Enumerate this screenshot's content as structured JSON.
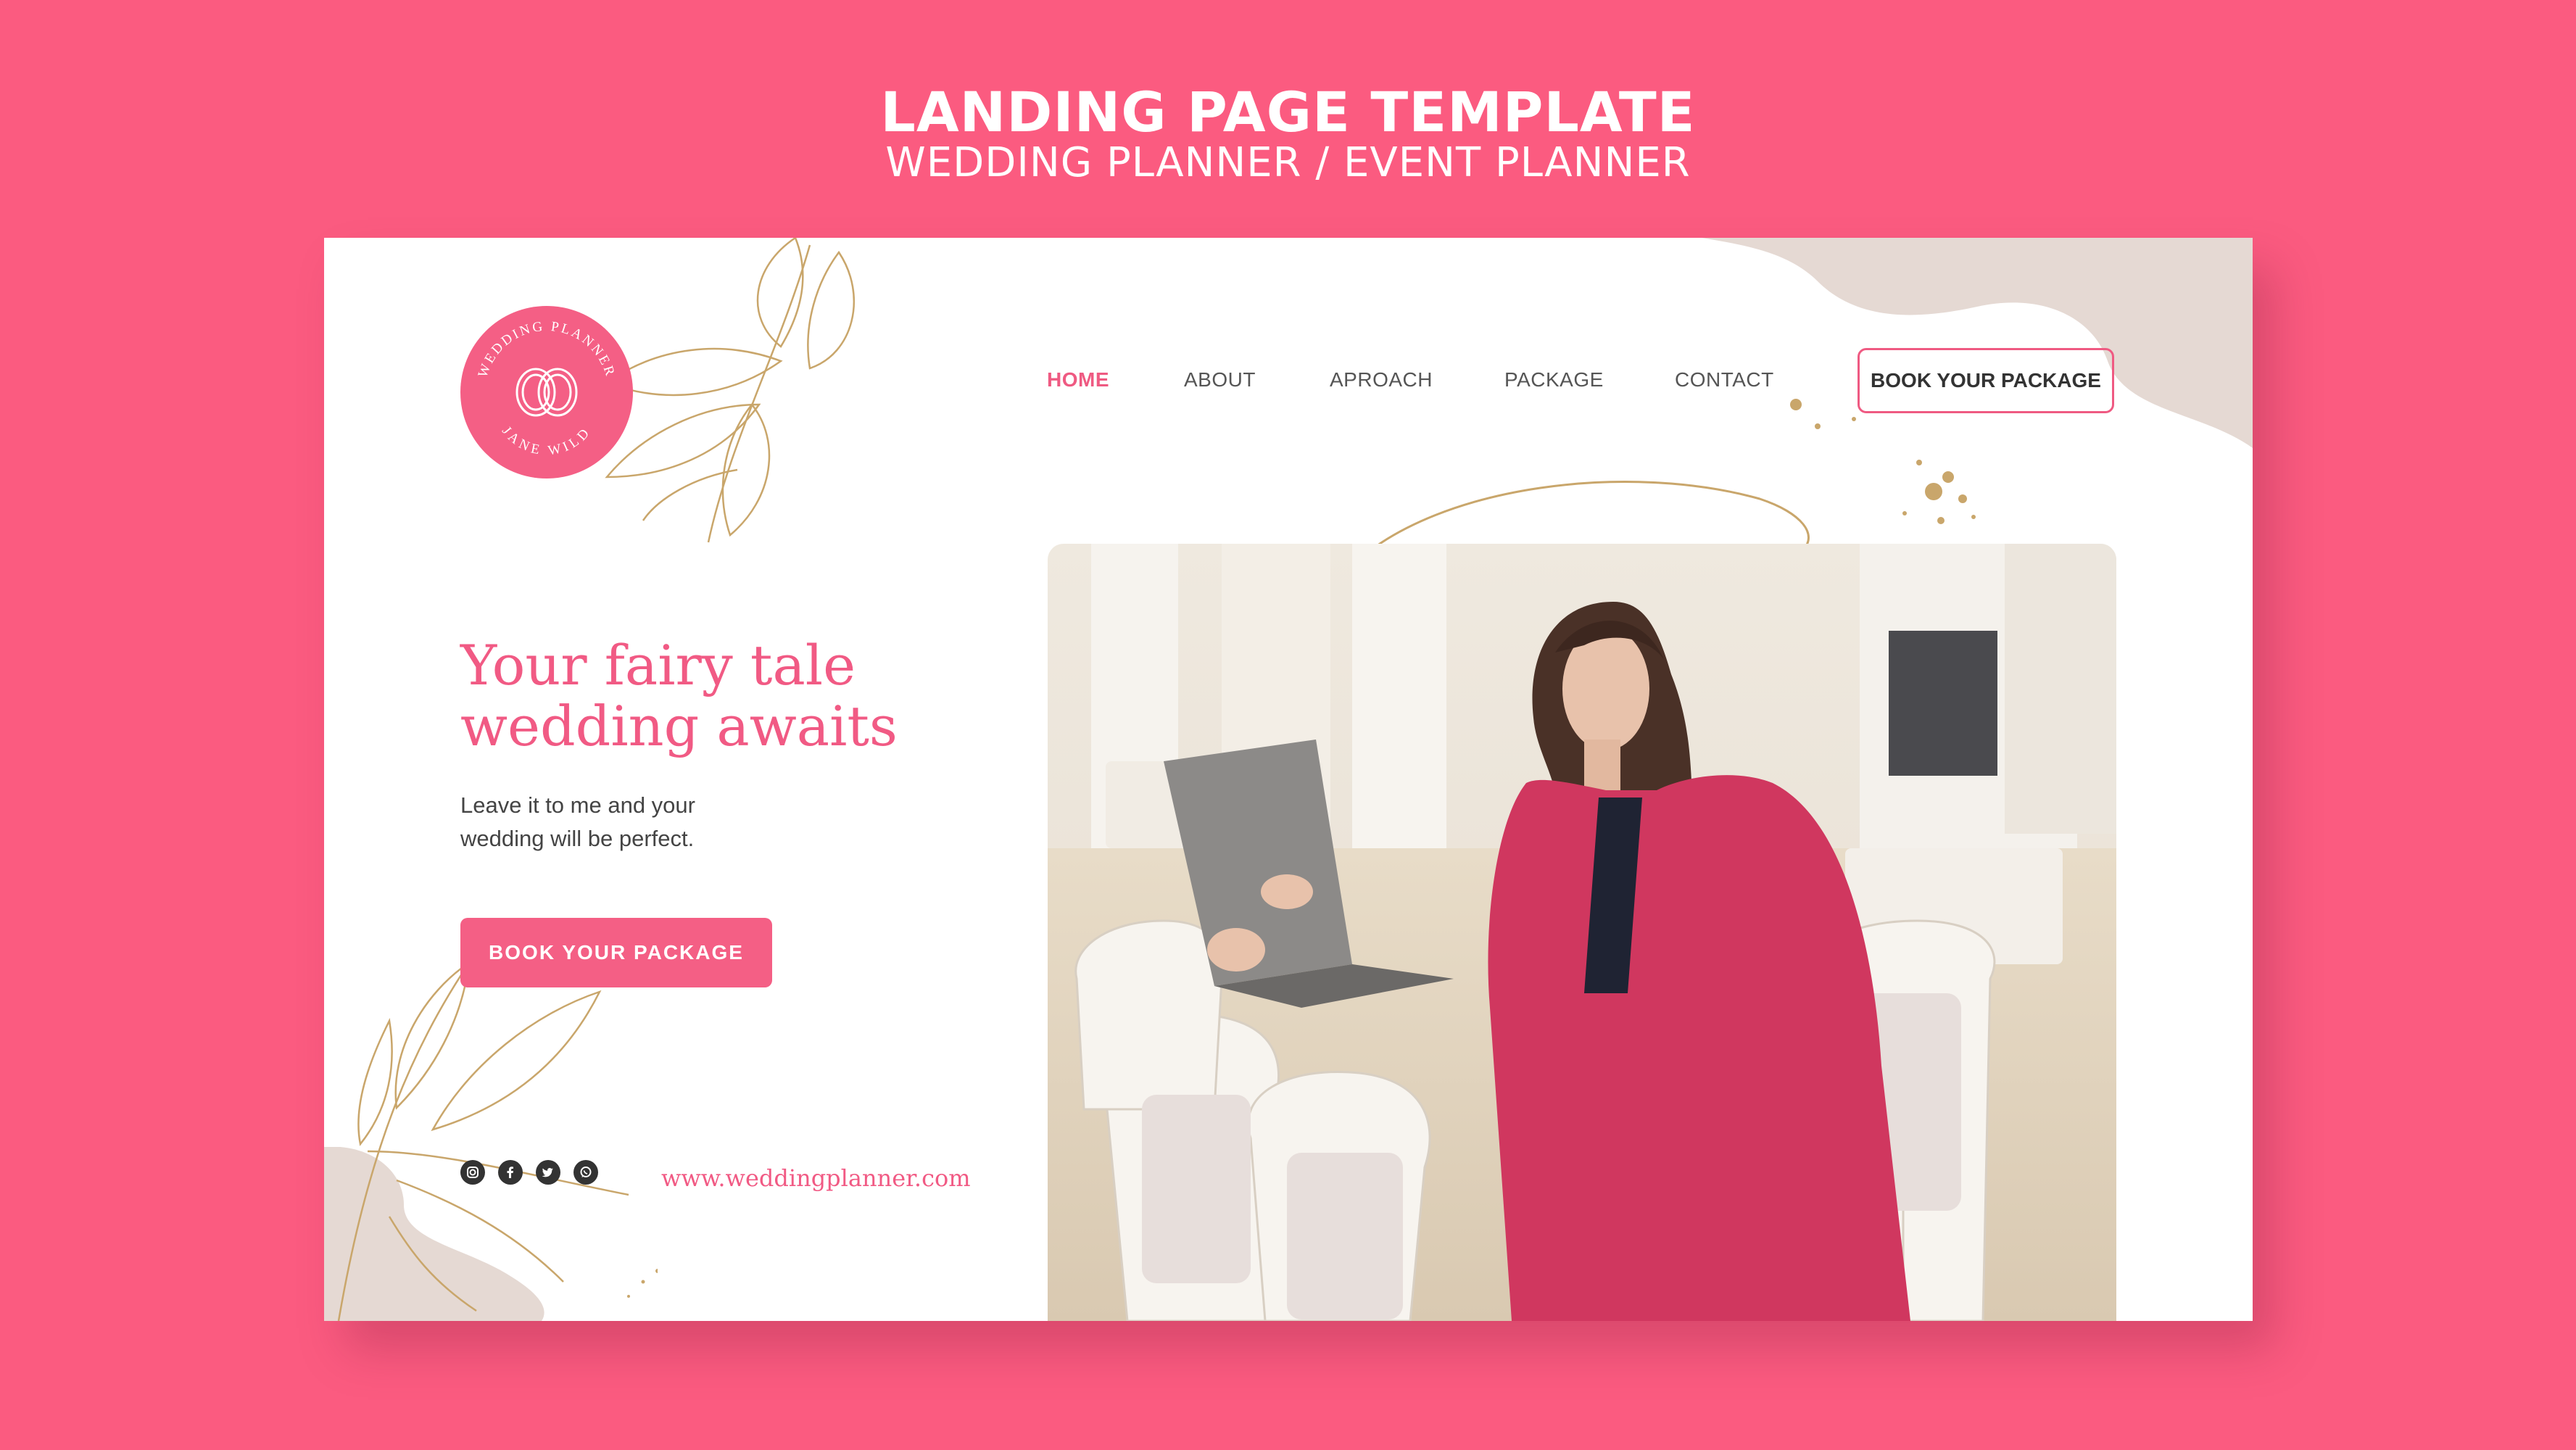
{
  "header": {
    "title": "LANDING PAGE TEMPLATE",
    "subtitle": "WEDDING PLANNER / EVENT PLANNER"
  },
  "logo": {
    "top_text": "WEDDING PLANNER",
    "bottom_text": "JANE WILD"
  },
  "nav": {
    "items": [
      {
        "label": "HOME",
        "active": true
      },
      {
        "label": "ABOUT",
        "active": false
      },
      {
        "label": "APROACH",
        "active": false
      },
      {
        "label": "PACKAGE",
        "active": false
      },
      {
        "label": "CONTACT",
        "active": false
      }
    ],
    "cta": "BOOK YOUR PACKAGE"
  },
  "hero": {
    "title_line1": "Your fairy tale",
    "title_line2": "wedding awaits",
    "subtitle_line1": "Leave it to me and your",
    "subtitle_line2": "wedding will be perfect.",
    "cta": "BOOK YOUR PACKAGE"
  },
  "footer": {
    "socials": [
      "instagram-icon",
      "facebook-icon",
      "twitter-icon",
      "whatsapp-icon"
    ],
    "url": "www.weddingplanner.com"
  },
  "colors": {
    "brand_pink": "#f45f85",
    "background": "#fb5b80",
    "beige": "#e5d9d3",
    "gold": "#c9a66b"
  }
}
